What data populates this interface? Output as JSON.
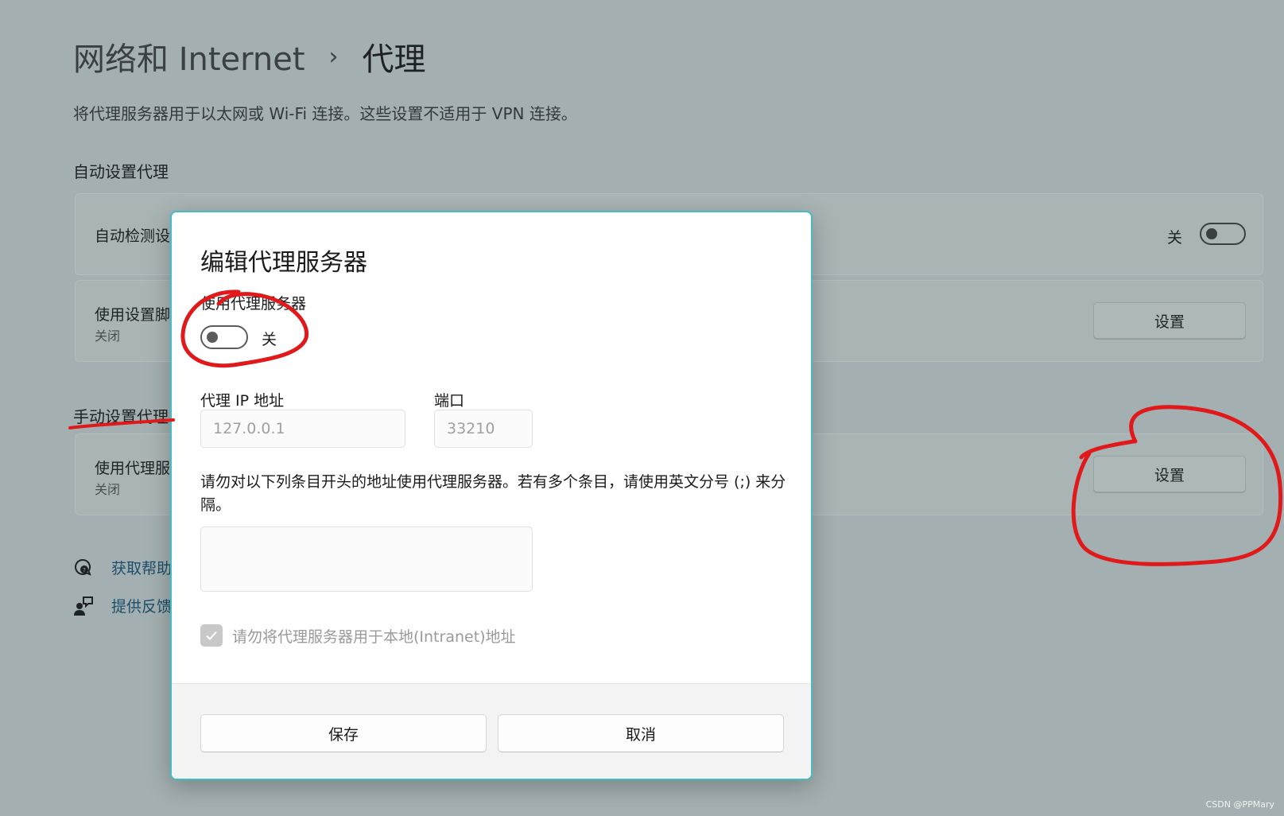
{
  "breadcrumb": {
    "parent": "网络和 Internet",
    "separator": "›",
    "current": "代理"
  },
  "description": "将代理服务器用于以太网或 Wi-Fi 连接。这些设置不适用于 VPN 连接。",
  "auto_section": {
    "title": "自动设置代理",
    "detect_row": {
      "title": "自动检测设",
      "state": "关"
    },
    "script_row": {
      "title": "使用设置脚",
      "subtitle": "关闭",
      "button": "设置"
    }
  },
  "manual_section": {
    "title": "手动设置代理",
    "proxy_row": {
      "title": "使用代理服",
      "subtitle": "关闭",
      "button": "设置"
    }
  },
  "links": {
    "help": {
      "label": "获取帮助",
      "icon": "help-chat-icon"
    },
    "feedback": {
      "label": "提供反馈",
      "icon": "feedback-person-icon"
    }
  },
  "dialog": {
    "title": "编辑代理服务器",
    "use_proxy_label": "使用代理服务器",
    "toggle_state": "关",
    "ip_label": "代理 IP 地址",
    "ip_placeholder": "127.0.0.1",
    "port_label": "端口",
    "port_placeholder": "33210",
    "exceptions_text": "请勿对以下列条目开头的地址使用代理服务器。若有多个条目，请使用英文分号 (;) 来分隔。",
    "local_checkbox_label": "请勿将代理服务器用于本地(Intranet)地址",
    "save_label": "保存",
    "cancel_label": "取消"
  },
  "watermark": "CSDN @PPMary",
  "colors": {
    "accent": "#45bcc0",
    "annotation": "#e0191b",
    "link": "#1b4f6b"
  }
}
